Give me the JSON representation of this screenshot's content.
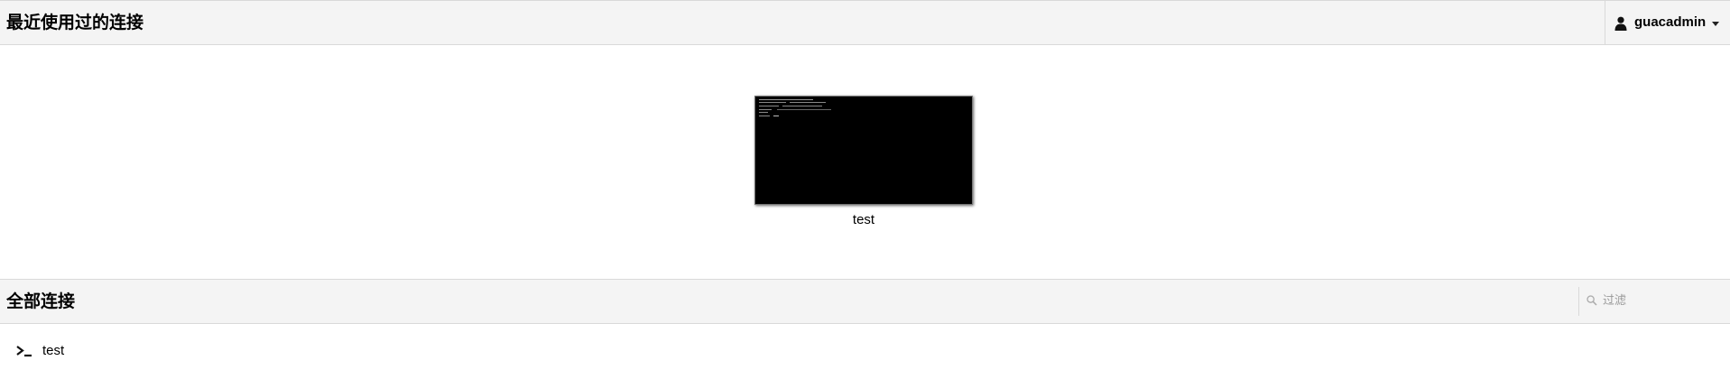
{
  "recent": {
    "title": "最近使用过的连接",
    "items": [
      {
        "label": "test"
      }
    ]
  },
  "user_menu": {
    "username": "guacadmin",
    "icon": "user-icon"
  },
  "all": {
    "title": "全部连接",
    "filter_placeholder": "过滤",
    "items": [
      {
        "label": "test",
        "icon": "terminal-icon"
      }
    ]
  }
}
